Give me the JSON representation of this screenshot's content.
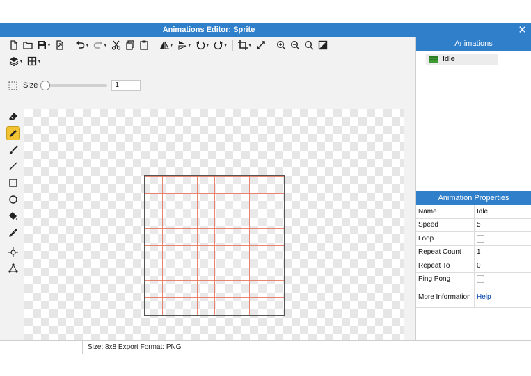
{
  "window": {
    "title": "Animations Editor: Sprite",
    "close_glyph": "✕"
  },
  "toolbar": {
    "row1": [
      "new-file-icon",
      "open-folder-icon",
      "save-icon",
      "export-icon",
      "undo-icon",
      "redo-icon",
      "cut-icon",
      "copy-icon",
      "paste-icon",
      "flip-horizontal-icon",
      "flip-vertical-icon",
      "rotate-left-icon",
      "rotate-right-icon",
      "crop-icon",
      "resize-icon",
      "zoom-in-icon",
      "zoom-out-icon",
      "zoom-fit-icon",
      "invert-icon"
    ],
    "row2": [
      "layers-icon",
      "grid-icon"
    ]
  },
  "size_control": {
    "label": "Size",
    "value": "1"
  },
  "tools": [
    "eraser-icon",
    "pencil-icon",
    "brush-icon",
    "line-icon",
    "rectangle-icon",
    "ellipse-icon",
    "fill-bucket-icon",
    "eyedropper-icon",
    "pivot-icon",
    "polygon-icon"
  ],
  "status": {
    "text": "Size: 8x8   Export Format: PNG"
  },
  "animations": {
    "header": "Animations",
    "items": [
      {
        "label": "Idle"
      }
    ]
  },
  "properties": {
    "header": "Animation Properties",
    "rows": [
      {
        "key": "Name",
        "value": "Idle"
      },
      {
        "key": "Speed",
        "value": "5"
      },
      {
        "key": "Loop",
        "checkbox": false
      },
      {
        "key": "Repeat Count",
        "value": "1"
      },
      {
        "key": "Repeat To",
        "value": "0"
      },
      {
        "key": "Ping Pong",
        "checkbox": false
      },
      {
        "key": "More Information",
        "link": "Help"
      }
    ]
  },
  "colors": {
    "accent": "#2f7fcb",
    "active_tool": "#f1c232",
    "grid_line": "#e57864"
  }
}
